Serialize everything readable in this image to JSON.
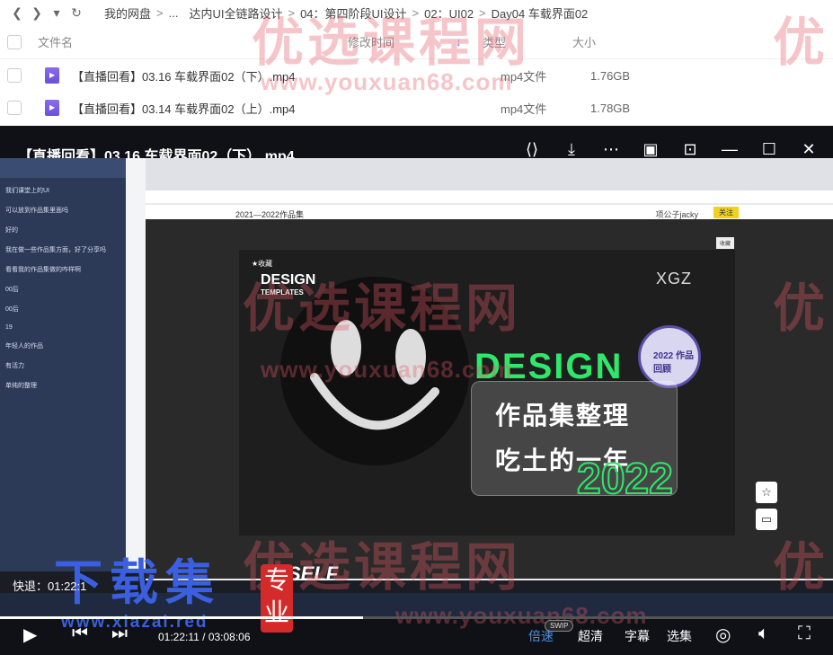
{
  "browser": {
    "nav": {
      "back": "❮",
      "forward": "❯",
      "menu": "▾",
      "refresh": "↻"
    },
    "crumbs": [
      "我的网盘",
      "...",
      "达内UI全链路设计",
      "04：第四阶段UI设计",
      "02：UI02",
      "Day04 车载界面02"
    ],
    "headers": {
      "name": "文件名",
      "mtime": "修改时间",
      "sort": "↓",
      "type": "类型",
      "size": "大小"
    },
    "files": [
      {
        "name": "【直播回看】03.16 车载界面02（下）.mp4",
        "type": "mp4文件",
        "size": "1.76GB"
      },
      {
        "name": "【直播回看】03.14 车载界面02（上）.mp4",
        "type": "mp4文件",
        "size": "1.78GB"
      }
    ]
  },
  "player": {
    "title": "【直播回看】03.16 车载界面02（下）.mp4",
    "quick_back": "快退：01:22:1",
    "time": "01:22:11 / 03:08:06",
    "progress_fraction": 0.436,
    "swip": "SWIP",
    "speed": "倍速",
    "quality": "超清",
    "subtitle": "字幕",
    "episodes": "选集"
  },
  "screen": {
    "page_heading": "2021—2022作品集",
    "user": "项公子jacky",
    "follow": "关注",
    "collect": "收藏",
    "fav": "★收藏",
    "design_templates": "DESIGN",
    "templates_sub": "TEMPLATES",
    "xgz": "XGZ",
    "design_green": "DESIGN",
    "card_line1": "作品集整理",
    "card_line2": "吃土的一年",
    "year": "2022",
    "badge": "2022 作品回顾",
    "self": "SELF",
    "chat_lines": [
      "我们课堂上的UI",
      "可以放到作品集里面吗",
      "好的",
      "我在做一些作品集方面，好了分享吗",
      "看看我的作品集做的咋样啊",
      "00后",
      "00后",
      "19",
      "年轻人的作品",
      "有活力",
      "单纯的整理"
    ]
  },
  "watermark": {
    "brand": "优选课程网",
    "url": "www.youxuan68.com",
    "brand_short": "优",
    "download_title": "下载集",
    "download_seal": "专业",
    "download_url": "www.xiazai.red"
  }
}
